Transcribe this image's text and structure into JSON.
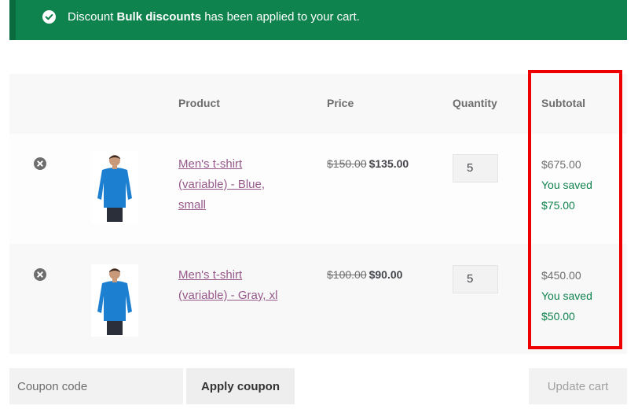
{
  "notice": {
    "prefix": "Discount",
    "discount_name": "Bulk discounts",
    "suffix": "has been applied to your cart.",
    "background": "#0f834d"
  },
  "table": {
    "headers": [
      "Product",
      "Price",
      "Quantity",
      "Subtotal"
    ]
  },
  "items": [
    {
      "name": "Men's t-shirt (variable) - Blue, small",
      "regular_price": "$150.00",
      "sale_price": "$135.00",
      "quantity": "5",
      "subtotal": "$675.00",
      "saved_label": "You saved",
      "saved_amount": "$75.00"
    },
    {
      "name": "Men's t-shirt (variable) - Gray, xl",
      "regular_price": "$100.00",
      "sale_price": "$90.00",
      "quantity": "5",
      "subtotal": "$450.00",
      "saved_label": "You saved",
      "saved_amount": "$50.00"
    }
  ],
  "coupon": {
    "placeholder": "Coupon code",
    "apply_label": "Apply coupon"
  },
  "update_label": "Update cart",
  "colors": {
    "link": "#96588a",
    "saved": "#0f834d",
    "highlight": "#ee0000"
  }
}
